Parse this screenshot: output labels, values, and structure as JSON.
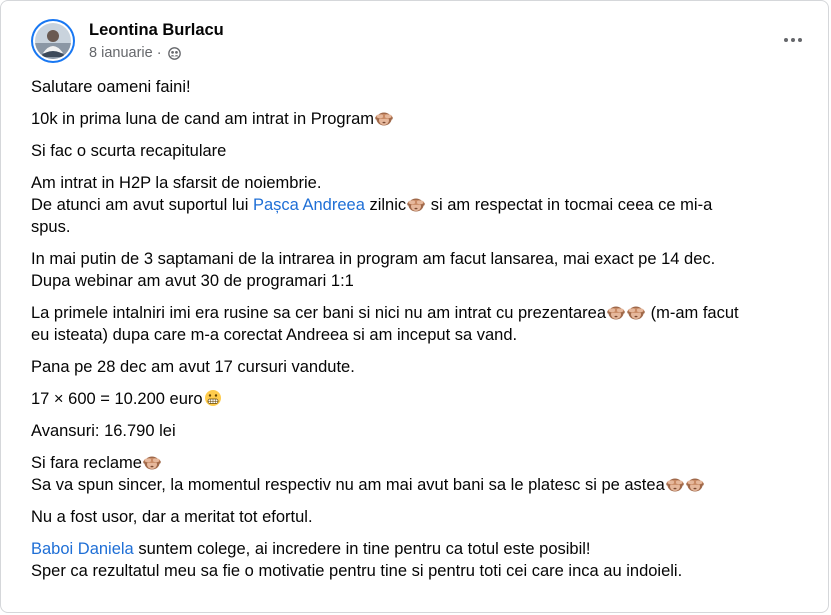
{
  "post": {
    "author": "Leontina Burlacu",
    "date": "8 ianuarie",
    "separator": "·",
    "audience_icon": "friends-icon",
    "more_icon": "more-options-icon",
    "lines": {
      "l1": "Salutare oameni faini!",
      "l2": "10k in prima luna de cand am intrat in Program",
      "l3": "Si fac o scurta recapitulare",
      "l4a": "Am intrat in H2P la sfarsit de noiembrie.",
      "l4b_pre": "De atunci am avut suportul lui ",
      "l4b_mention": "Pașca Andreea",
      "l4b_mid": "  zilnic",
      "l4b_post": " si am respectat in tocmai ceea ce mi-a",
      "l4c": "spus.",
      "l5a": "In mai putin de 3 saptamani de la intrarea in program am facut lansarea, mai exact pe 14 dec.",
      "l5b": "Dupa webinar am avut 30 de programari 1:1",
      "l6a_pre": "La primele intalniri imi era rusine sa cer bani si nici nu am intrat cu prezentarea",
      "l6a_post": " (m-am facut",
      "l6b": "eu isteata) dupa care m-a corectat Andreea si am inceput sa vand.",
      "l7": "Pana pe 28 dec am avut 17 cursuri vandute.",
      "l8": "17 × 600 = 10.200 euro",
      "l9": "Avansuri: 16.790 lei",
      "l10a": "Si fara reclame",
      "l10b": "Sa va spun sincer, la momentul respectiv nu am mai avut bani sa le platesc si pe astea",
      "l11": "Nu a fost usor, dar a meritat tot efortul.",
      "l12_mention": "Baboi Daniela",
      "l12_post": "  suntem colege, ai incredere in tine pentru ca totul este posibil!",
      "l13": "Sper ca rezultatul meu sa fie o motivatie pentru tine si pentru toti cei care inca au indoieli."
    },
    "emoji": {
      "monkey": "see-no-evil-monkey-icon",
      "grin": "grimacing-face-icon"
    },
    "colors": {
      "mention": "#1f6fd6",
      "meta": "#65676b",
      "avatar_ring": "#1877f2"
    }
  }
}
